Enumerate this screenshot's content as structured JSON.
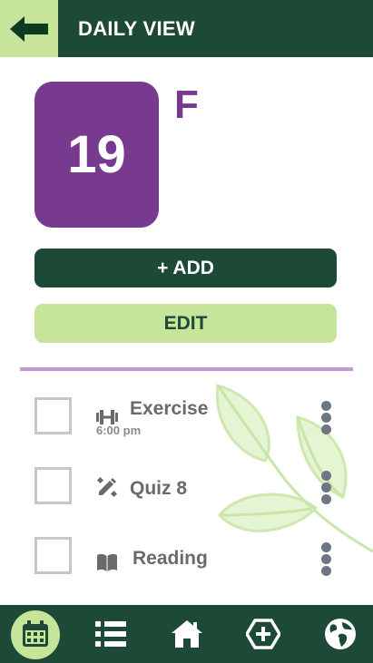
{
  "header": {
    "title": "DAILY VIEW",
    "back_icon": "arrow-left-icon"
  },
  "date": {
    "day_number": "19",
    "day_letter": "F"
  },
  "actions": {
    "add_label": "+ ADD",
    "edit_label": "EDIT"
  },
  "tasks": [
    {
      "label": "Exercise",
      "time": "6:00 pm",
      "icon": "dumbbell-icon",
      "checked": false
    },
    {
      "label": "Quiz 8",
      "time": "",
      "icon": "pencil-ruler-icon",
      "checked": false
    },
    {
      "label": "Reading",
      "time": "",
      "icon": "book-icon",
      "checked": false
    }
  ],
  "nav": {
    "items": [
      {
        "icon": "calendar-icon",
        "active": true
      },
      {
        "icon": "list-icon",
        "active": false
      },
      {
        "icon": "home-icon",
        "active": false
      },
      {
        "icon": "add-circle-icon",
        "active": false
      },
      {
        "icon": "globe-icon",
        "active": false
      }
    ]
  },
  "colors": {
    "dark_green": "#1c4a36",
    "light_green": "#c6e49a",
    "purple": "#773a8e",
    "divider": "#c29bcc"
  }
}
